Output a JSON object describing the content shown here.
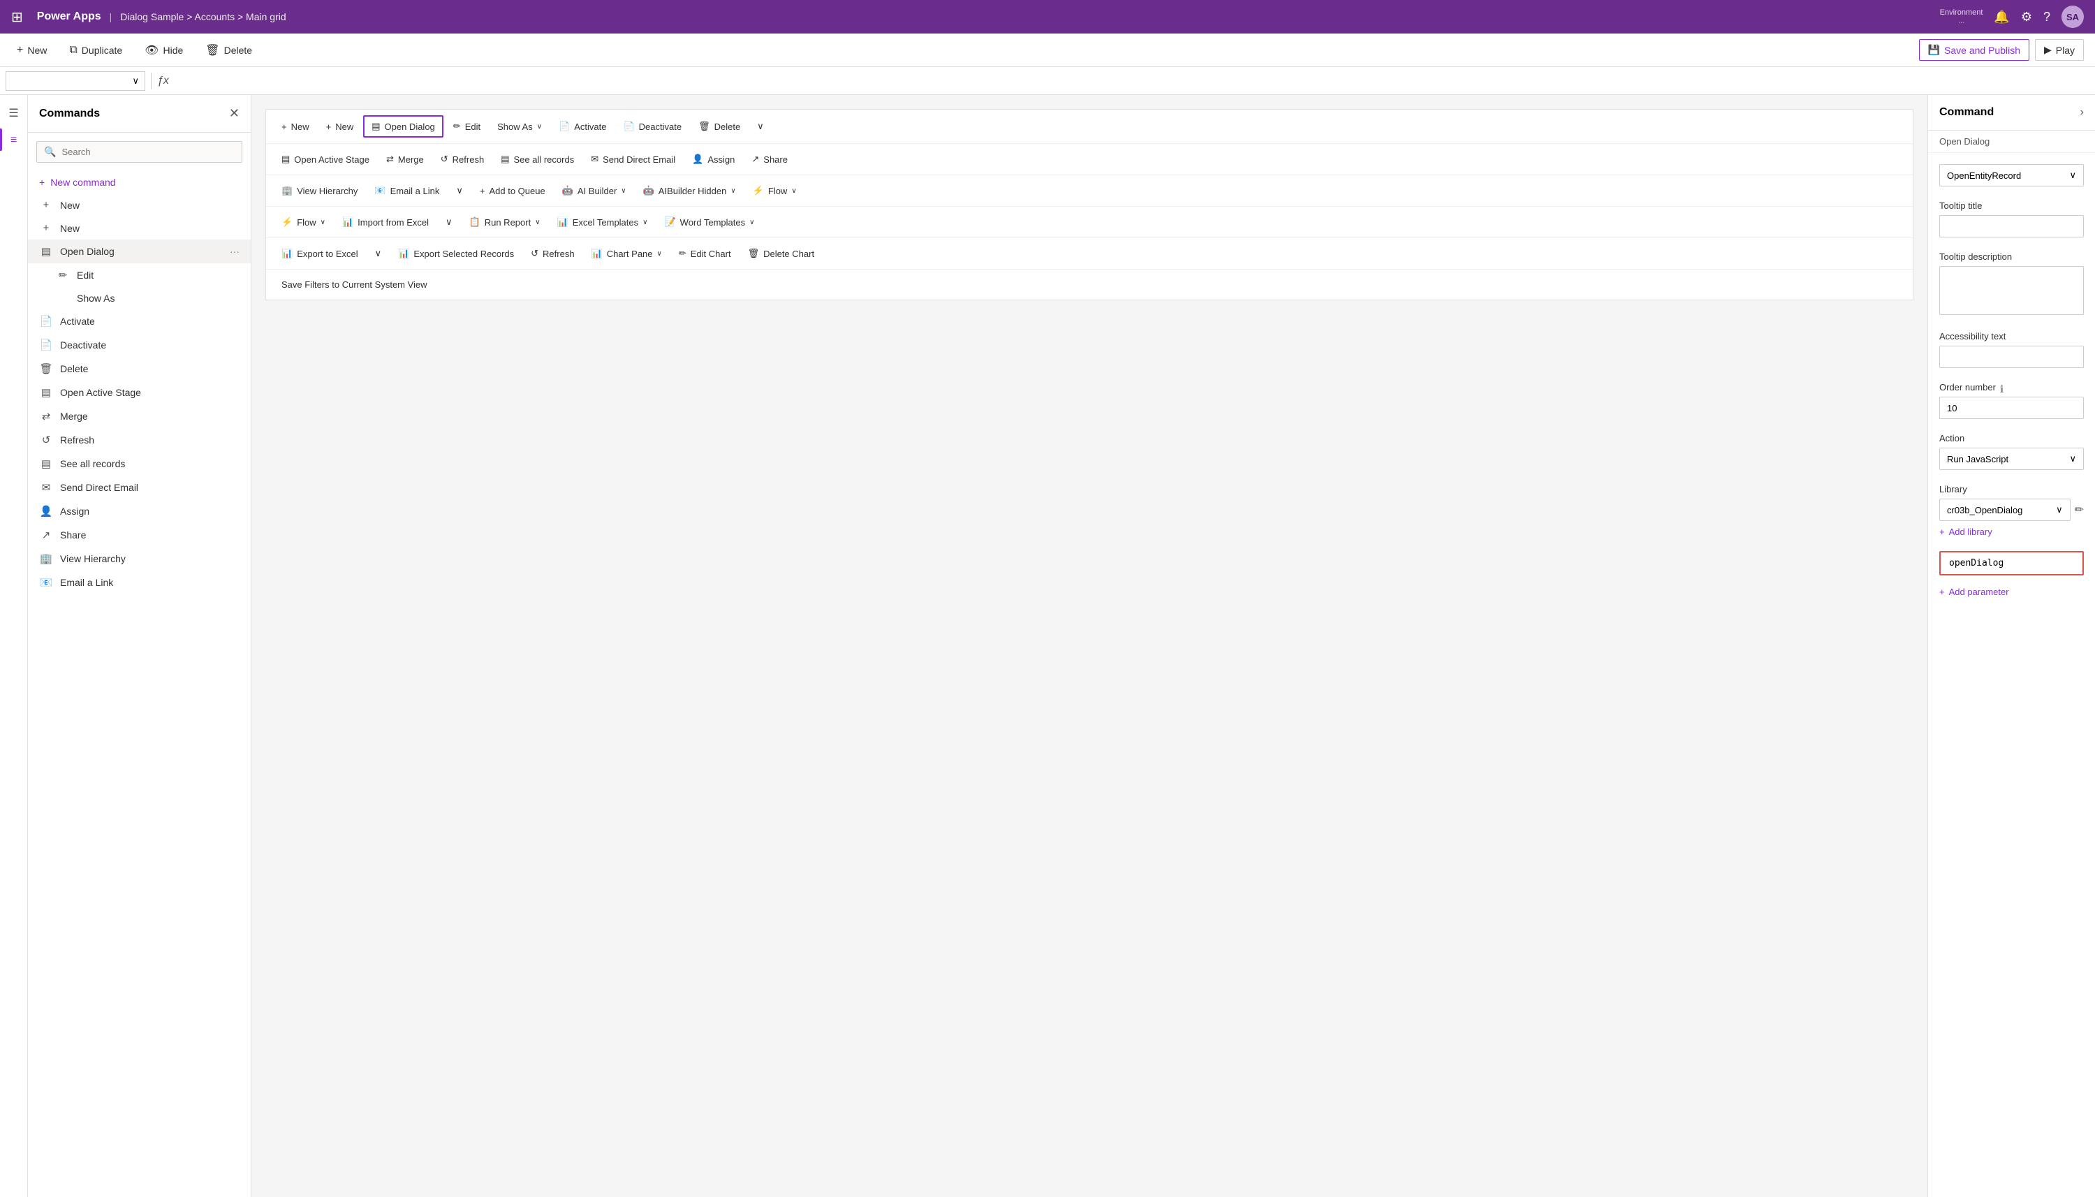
{
  "topnav": {
    "waffle": "⊞",
    "app_title": "Power Apps",
    "separator": "|",
    "breadcrumb": "Dialog Sample > Accounts > Main grid",
    "env_label": "Environment",
    "env_name": "...",
    "avatar_initials": "SA"
  },
  "toolbar": {
    "new_label": "New",
    "duplicate_label": "Duplicate",
    "hide_label": "Hide",
    "delete_label": "Delete",
    "save_publish_label": "Save and Publish",
    "play_label": "Play"
  },
  "commands_panel": {
    "title": "Commands",
    "search_placeholder": "Search",
    "add_command_label": "New command",
    "items": [
      {
        "id": "new1",
        "icon": "+",
        "label": "New",
        "indent": false
      },
      {
        "id": "new2",
        "icon": "+",
        "label": "New",
        "indent": false
      },
      {
        "id": "open_dialog",
        "icon": "▤",
        "label": "Open Dialog",
        "indent": false,
        "active": true,
        "has_more": true
      },
      {
        "id": "edit",
        "icon": "✏",
        "label": "Edit",
        "indent": true
      },
      {
        "id": "show_as",
        "icon": "",
        "label": "Show As",
        "indent": true
      },
      {
        "id": "activate",
        "icon": "📄",
        "label": "Activate",
        "indent": false
      },
      {
        "id": "deactivate",
        "icon": "📄",
        "label": "Deactivate",
        "indent": false
      },
      {
        "id": "delete",
        "icon": "🗑",
        "label": "Delete",
        "indent": false
      },
      {
        "id": "open_active_stage",
        "icon": "▤",
        "label": "Open Active Stage",
        "indent": false
      },
      {
        "id": "merge",
        "icon": "⇄",
        "label": "Merge",
        "indent": false
      },
      {
        "id": "refresh",
        "icon": "↺",
        "label": "Refresh",
        "indent": false
      },
      {
        "id": "see_all_records",
        "icon": "▤",
        "label": "See all records",
        "indent": false
      },
      {
        "id": "send_direct_email",
        "icon": "✉",
        "label": "Send Direct Email",
        "indent": false
      },
      {
        "id": "assign",
        "icon": "👤",
        "label": "Assign",
        "indent": false
      },
      {
        "id": "share",
        "icon": "↗",
        "label": "Share",
        "indent": false
      },
      {
        "id": "view_hierarchy",
        "icon": "🏢",
        "label": "View Hierarchy",
        "indent": false
      },
      {
        "id": "email_a_link",
        "icon": "📧",
        "label": "Email a Link",
        "indent": false
      }
    ]
  },
  "ribbon": {
    "rows": [
      {
        "buttons": [
          {
            "id": "new1",
            "icon": "+",
            "label": "New",
            "dropdown": false
          },
          {
            "id": "new2",
            "icon": "+",
            "label": "New",
            "dropdown": false
          },
          {
            "id": "open_dialog",
            "icon": "▤",
            "label": "Open Dialog",
            "highlighted": true
          },
          {
            "id": "edit",
            "icon": "✏",
            "label": "Edit",
            "dropdown": false
          },
          {
            "id": "show_as",
            "icon": "",
            "label": "Show As",
            "dropdown": true
          },
          {
            "id": "activate",
            "icon": "📄",
            "label": "Activate",
            "dropdown": false
          },
          {
            "id": "deactivate",
            "icon": "📄",
            "label": "Deactivate",
            "dropdown": false
          },
          {
            "id": "delete",
            "icon": "🗑",
            "label": "Delete",
            "dropdown": false
          },
          {
            "id": "more1",
            "icon": "∨",
            "label": "",
            "dropdown": false
          }
        ]
      },
      {
        "buttons": [
          {
            "id": "open_active_stage",
            "icon": "▤",
            "label": "Open Active Stage",
            "dropdown": false
          },
          {
            "id": "merge",
            "icon": "⇄",
            "label": "Merge",
            "dropdown": false
          },
          {
            "id": "refresh",
            "icon": "↺",
            "label": "Refresh",
            "dropdown": false
          },
          {
            "id": "see_all_records",
            "icon": "▤",
            "label": "See all records",
            "dropdown": false
          },
          {
            "id": "send_direct_email",
            "icon": "✉",
            "label": "Send Direct Email",
            "dropdown": false
          },
          {
            "id": "assign",
            "icon": "👤",
            "label": "Assign",
            "dropdown": false
          },
          {
            "id": "share",
            "icon": "↗",
            "label": "Share",
            "dropdown": false
          }
        ]
      },
      {
        "buttons": [
          {
            "id": "view_hierarchy",
            "icon": "🏢",
            "label": "View Hierarchy",
            "dropdown": false
          },
          {
            "id": "email_a_link",
            "icon": "📧",
            "label": "Email a Link",
            "dropdown": false
          },
          {
            "id": "split1",
            "icon": "∨",
            "label": "",
            "dropdown": false
          },
          {
            "id": "add_to_queue",
            "icon": "+",
            "label": "Add to Queue",
            "dropdown": false
          },
          {
            "id": "ai_builder",
            "icon": "🤖",
            "label": "AI Builder",
            "dropdown": true
          },
          {
            "id": "ai_builder_hidden",
            "icon": "🤖",
            "label": "AIBuilder Hidden",
            "dropdown": true
          },
          {
            "id": "flow",
            "icon": "⚡",
            "label": "Flow",
            "dropdown": true
          }
        ]
      },
      {
        "buttons": [
          {
            "id": "flow2",
            "icon": "⚡",
            "label": "Flow",
            "dropdown": true
          },
          {
            "id": "import_from_excel",
            "icon": "📊",
            "label": "Import from Excel",
            "dropdown": false
          },
          {
            "id": "split2",
            "icon": "∨",
            "label": "",
            "dropdown": false
          },
          {
            "id": "run_report",
            "icon": "📋",
            "label": "Run Report",
            "dropdown": true
          },
          {
            "id": "excel_templates",
            "icon": "📊",
            "label": "Excel Templates",
            "dropdown": true
          },
          {
            "id": "word_templates",
            "icon": "📝",
            "label": "Word Templates",
            "dropdown": true
          }
        ]
      },
      {
        "buttons": [
          {
            "id": "export_to_excel",
            "icon": "📊",
            "label": "Export to Excel",
            "dropdown": false
          },
          {
            "id": "split3",
            "icon": "∨",
            "label": "",
            "dropdown": false
          },
          {
            "id": "export_selected",
            "icon": "📊",
            "label": "Export Selected Records",
            "dropdown": false
          },
          {
            "id": "refresh2",
            "icon": "↺",
            "label": "Refresh",
            "dropdown": false
          },
          {
            "id": "chart_pane",
            "icon": "📊",
            "label": "Chart Pane",
            "dropdown": true
          },
          {
            "id": "edit_chart",
            "icon": "✏",
            "label": "Edit Chart",
            "dropdown": false
          },
          {
            "id": "delete_chart",
            "icon": "🗑",
            "label": "Delete Chart",
            "dropdown": false
          }
        ]
      },
      {
        "buttons": [
          {
            "id": "save_filters",
            "icon": "",
            "label": "Save Filters to Current System View",
            "dropdown": false
          }
        ]
      }
    ]
  },
  "props_panel": {
    "title": "Command",
    "subtitle": "Open Dialog",
    "action_type_label": "OpenEntityRecord",
    "tooltip_title_label": "Tooltip title",
    "tooltip_title_value": "",
    "tooltip_desc_label": "Tooltip description",
    "tooltip_desc_value": "",
    "accessibility_label": "Accessibility text",
    "accessibility_value": "",
    "order_label": "Order number",
    "order_value": "10",
    "action_label": "Action",
    "action_value": "Run JavaScript",
    "library_label": "Library",
    "library_value": "cr03b_OpenDialog",
    "add_library_label": "Add library",
    "fn_value": "openDialog",
    "add_param_label": "Add parameter"
  }
}
